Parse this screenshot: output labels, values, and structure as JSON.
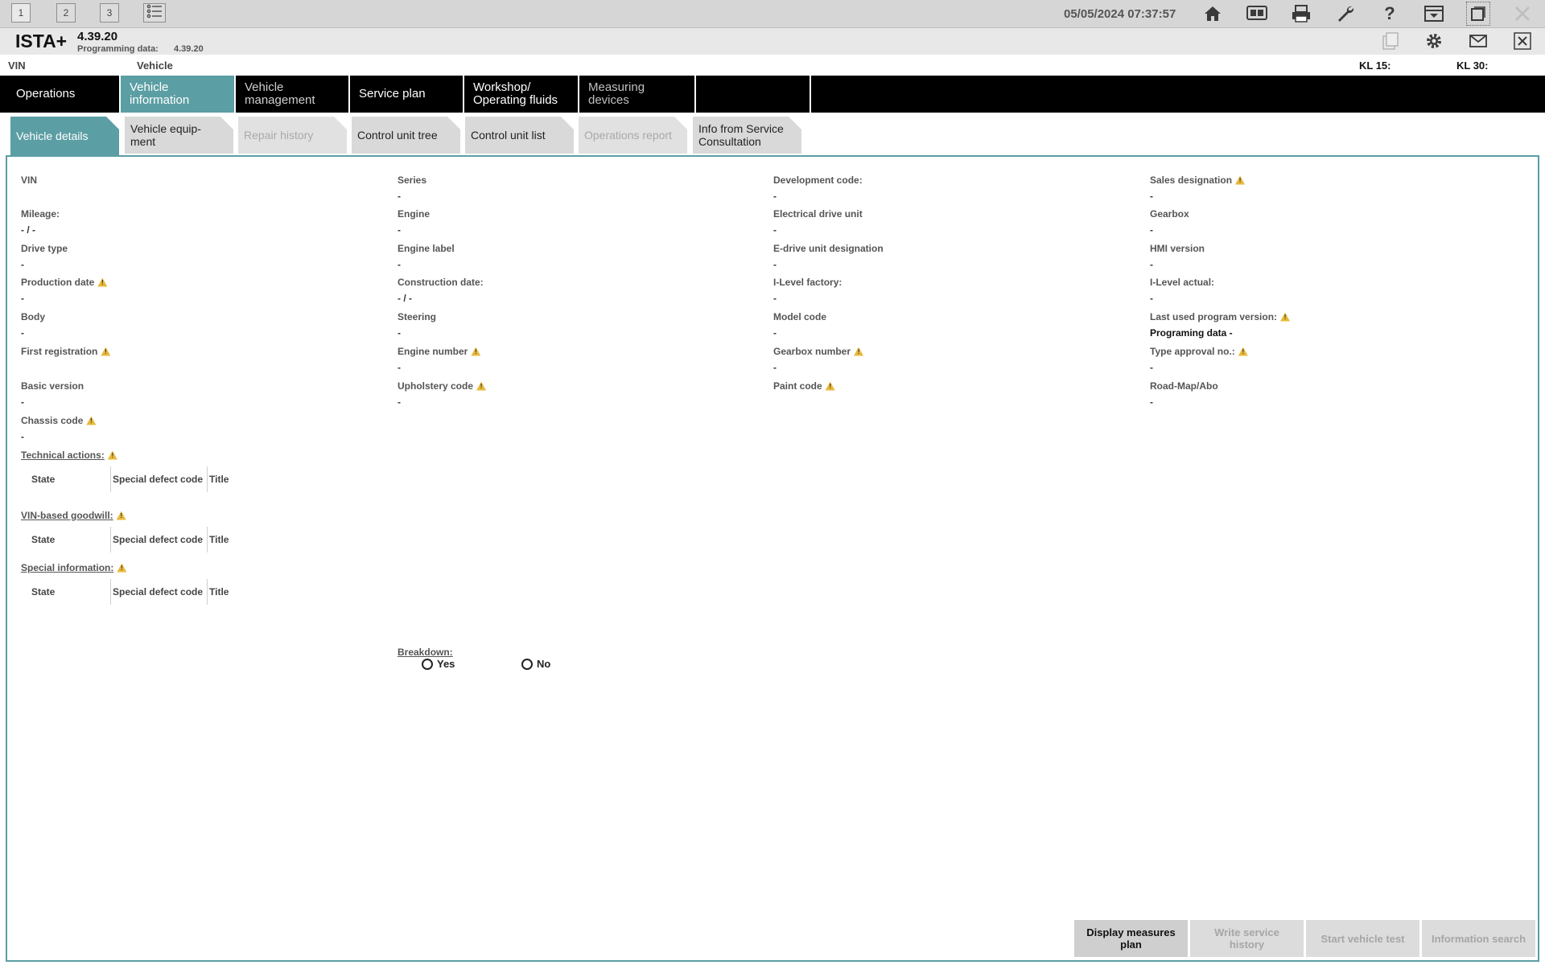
{
  "topbar": {
    "windows": [
      "1",
      "2",
      "3"
    ],
    "datetime": "05/05/2024 07:37:57",
    "icons": [
      "list-icon",
      "home-icon",
      "bmw-logo-icon",
      "print-icon",
      "wrench-icon",
      "help-icon",
      "dropdown-window-icon",
      "maximize-icon",
      "close-icon"
    ]
  },
  "header": {
    "app_name": "ISTA+",
    "version": "4.39.20",
    "programming_label": "Programming data:",
    "programming_value": "4.39.20"
  },
  "vinrow": {
    "vin_label": "VIN",
    "vehicle_label": "Vehicle",
    "kl15_label": "KL 15:",
    "kl30_label": "KL 30:"
  },
  "nav": {
    "tabs": [
      {
        "label": "Operations"
      },
      {
        "label": "Vehicle information"
      },
      {
        "label": "Vehicle\nmanagement"
      },
      {
        "label": "Service plan"
      },
      {
        "label": "Workshop/\nOperating fluids"
      },
      {
        "label": "Measuring devices"
      }
    ]
  },
  "subtabs": [
    {
      "label": "Vehicle details"
    },
    {
      "label": "Vehicle equip-\nment"
    },
    {
      "label": "Repair history"
    },
    {
      "label": "Control unit tree"
    },
    {
      "label": "Control unit list"
    },
    {
      "label": "Operations report"
    },
    {
      "label": "Info from Service\nConsultation"
    }
  ],
  "details": {
    "col1": [
      {
        "label": "VIN",
        "value": ""
      },
      {
        "label": "Mileage:",
        "value": "- / -"
      },
      {
        "label": "Drive type",
        "value": "-"
      },
      {
        "label": "Production date",
        "value": "-"
      },
      {
        "label": "Body",
        "value": "-"
      },
      {
        "label": "First registration",
        "value": ""
      },
      {
        "label": "Basic version",
        "value": "-"
      },
      {
        "label": "Chassis code",
        "value": "-"
      }
    ],
    "col2": [
      {
        "label": "Series",
        "value": "-"
      },
      {
        "label": "Engine",
        "value": "-"
      },
      {
        "label": "Engine label",
        "value": "-"
      },
      {
        "label": "Construction date:",
        "value": "- / -"
      },
      {
        "label": "Steering",
        "value": "-"
      },
      {
        "label": "Engine number",
        "value": "-"
      },
      {
        "label": "Upholstery code",
        "value": "-"
      }
    ],
    "col3": [
      {
        "label": "Development code:",
        "value": "-"
      },
      {
        "label": "Electrical drive unit",
        "value": "-"
      },
      {
        "label": "E-drive unit designation",
        "value": "-"
      },
      {
        "label": "I-Level factory:",
        "value": "-"
      },
      {
        "label": "Model code",
        "value": "-"
      },
      {
        "label": "Gearbox number",
        "value": "-"
      },
      {
        "label": "Paint code",
        "value": ""
      }
    ],
    "col4": [
      {
        "label": "Sales designation",
        "value": "-"
      },
      {
        "label": "Gearbox",
        "value": "-"
      },
      {
        "label": "HMI version",
        "value": "-"
      },
      {
        "label": "I-Level actual:",
        "value": "-"
      },
      {
        "label": "Last used program version:",
        "value": "Programing data -"
      },
      {
        "label": "Type approval no.:",
        "value": "-"
      },
      {
        "label": "Road-Map/Abo",
        "value": "-"
      }
    ]
  },
  "sections": [
    {
      "title": "Technical actions:"
    },
    {
      "title": "VIN-based goodwill:"
    },
    {
      "title": "Special information:"
    }
  ],
  "table_columns": [
    "State",
    "Special defect code",
    "Title"
  ],
  "breakdown": {
    "label": "Breakdown:",
    "yes": "Yes",
    "no": "No"
  },
  "bottom_buttons": [
    {
      "label": "Display measures\nplan"
    },
    {
      "label": "Write service\nhistory"
    },
    {
      "label": "Start vehicle test"
    },
    {
      "label": "Information search"
    }
  ],
  "colors": {
    "accent": "#5b9ea4",
    "warning": "#e8b93b",
    "nav_bg": "#000000"
  }
}
